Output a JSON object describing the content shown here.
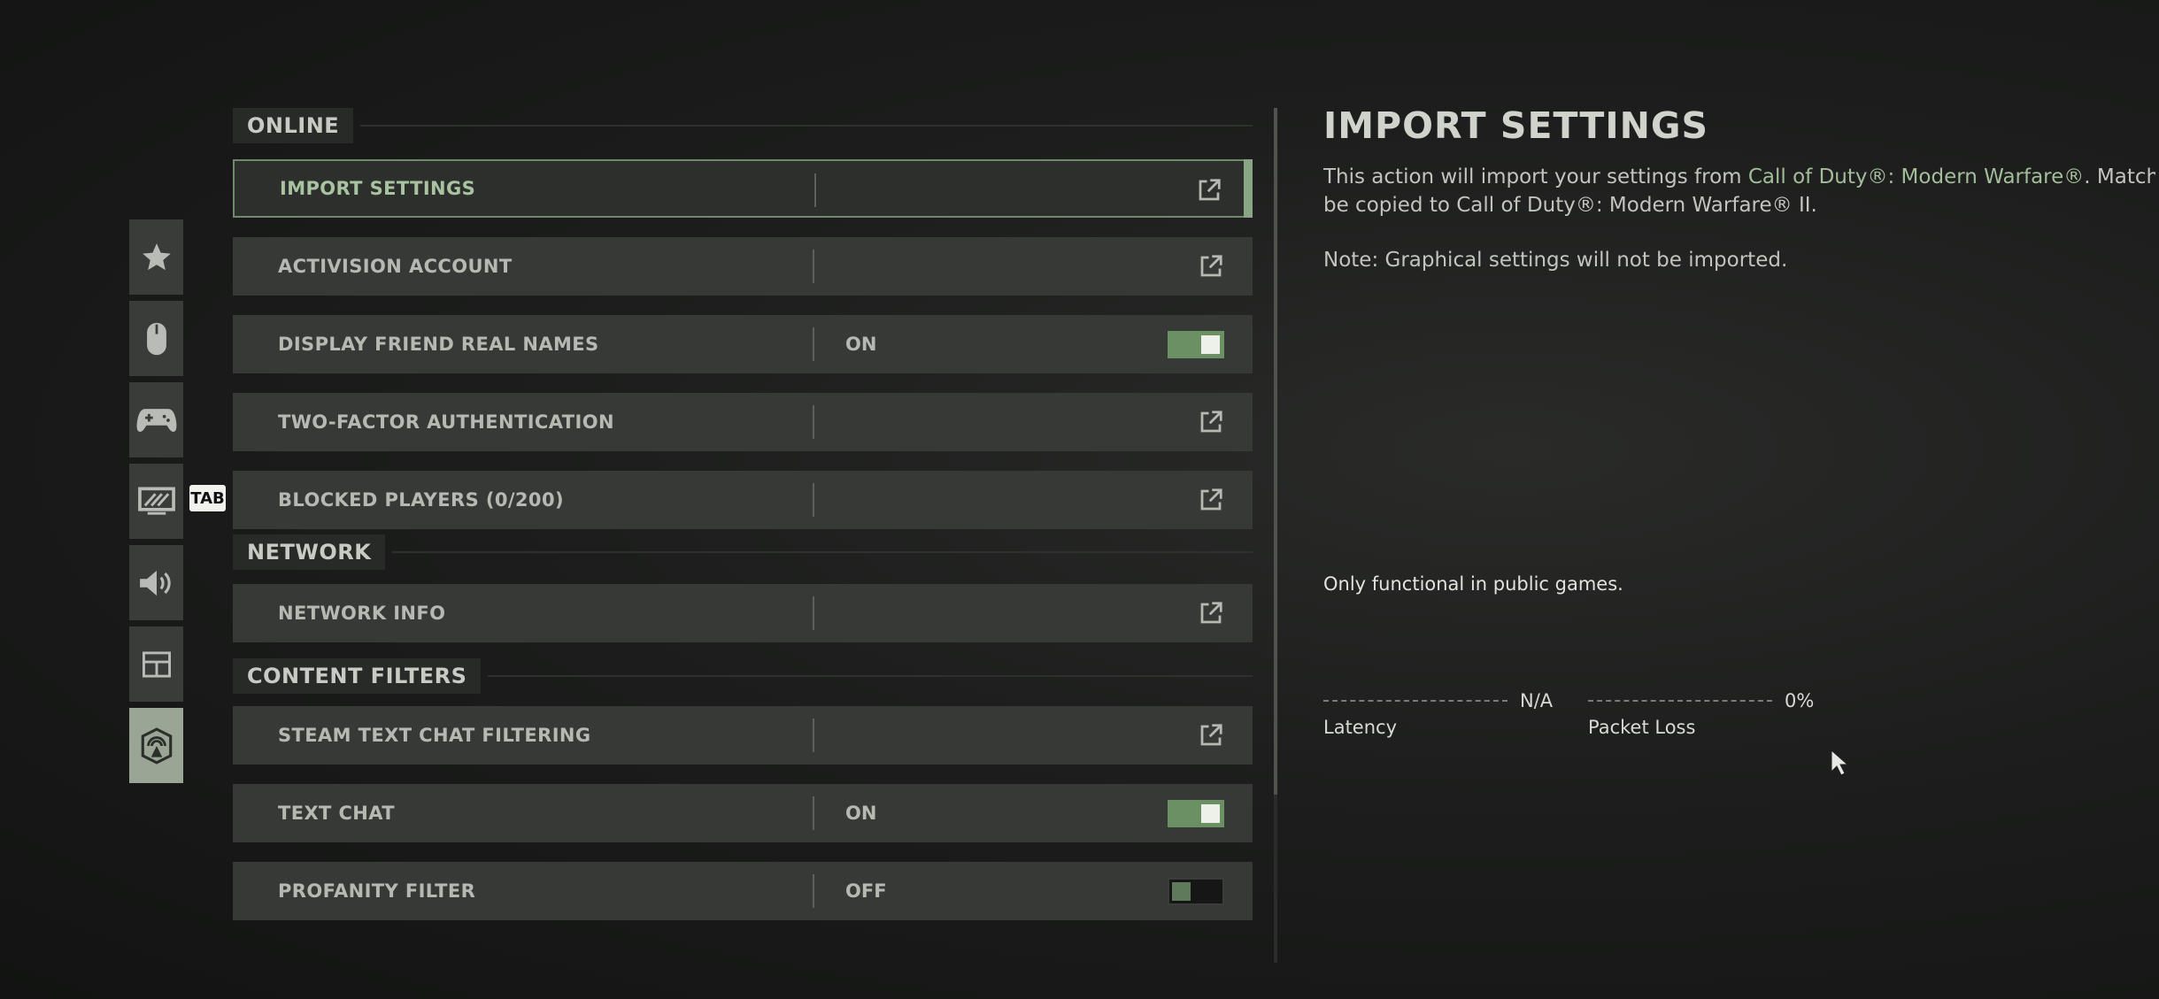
{
  "sidebar": {
    "tab_hint": "TAB",
    "items": [
      {
        "icon": "star-icon"
      },
      {
        "icon": "mouse-icon"
      },
      {
        "icon": "gamepad-icon"
      },
      {
        "icon": "display-icon"
      },
      {
        "icon": "speaker-icon"
      },
      {
        "icon": "interface-icon"
      },
      {
        "icon": "network-icon",
        "active": true
      }
    ]
  },
  "settings": {
    "online": {
      "label": "ONLINE",
      "rows": [
        {
          "label": "IMPORT SETTINGS",
          "control": "external",
          "selected": true
        },
        {
          "label": "ACTIVISION ACCOUNT",
          "control": "external"
        },
        {
          "label": "DISPLAY FRIEND REAL NAMES",
          "control": "toggle",
          "value": "ON"
        },
        {
          "label": "TWO-FACTOR AUTHENTICATION",
          "control": "external"
        },
        {
          "label": "BLOCKED PLAYERS (0/200)",
          "control": "external"
        }
      ]
    },
    "network": {
      "label": "NETWORK",
      "rows": [
        {
          "label": "NETWORK INFO",
          "control": "external"
        }
      ]
    },
    "content_filters": {
      "label": "CONTENT FILTERS",
      "rows": [
        {
          "label": "STEAM TEXT CHAT FILTERING",
          "control": "external"
        },
        {
          "label": "TEXT CHAT",
          "control": "toggle",
          "value": "ON"
        },
        {
          "label": "PROFANITY FILTER",
          "control": "toggle",
          "value": "OFF"
        }
      ]
    }
  },
  "info": {
    "title": "IMPORT SETTINGS",
    "desc_part1": "This action will import your settings from ",
    "desc_game1": "Call of Duty®: Modern Warfare®",
    "desc_part2": ". Matching",
    "desc_line2": "be copied to Call of Duty®: Modern Warfare® II.",
    "note": "Note: Graphical settings will not be imported.",
    "public_note": "Only functional in public games.",
    "latency": {
      "value": "N/A",
      "label": "Latency"
    },
    "packet_loss": {
      "value": "0%",
      "label": "Packet Loss"
    }
  },
  "colors": {
    "accent": "#8aa585",
    "toggle_on": "#6b9064",
    "row_bg": "#373936"
  }
}
